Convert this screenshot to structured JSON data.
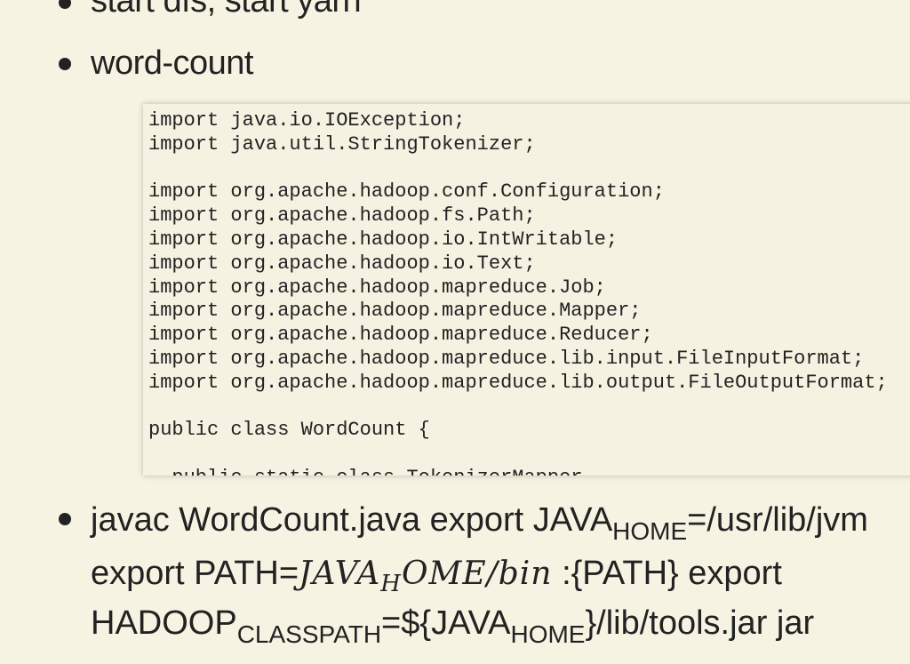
{
  "slide": {
    "bullets": [
      {
        "text": "start dfs, start yarn"
      },
      {
        "text": "word-count"
      }
    ],
    "code": {
      "lines": [
        "import java.io.IOException;",
        "import java.util.StringTokenizer;",
        "",
        "import org.apache.hadoop.conf.Configuration;",
        "import org.apache.hadoop.fs.Path;",
        "import org.apache.hadoop.io.IntWritable;",
        "import org.apache.hadoop.io.Text;",
        "import org.apache.hadoop.mapreduce.Job;",
        "import org.apache.hadoop.mapreduce.Mapper;",
        "import org.apache.hadoop.mapreduce.Reducer;",
        "import org.apache.hadoop.mapreduce.lib.input.FileInputFormat;",
        "import org.apache.hadoop.mapreduce.lib.output.FileOutputFormat;",
        "",
        "public class WordCount {",
        "",
        "  public static class TokenizerMapper"
      ]
    },
    "para": {
      "l1_a": "javac WordCount.java export JAVA",
      "l1_sub": "HOME",
      "l1_b": "=/usr/lib/jvm",
      "l2_a": "export PATH=",
      "l2_math_a": "JAVA",
      "l2_math_sub": "H",
      "l2_math_b": "OME/bin",
      "l2_b": ":{PATH} export",
      "l3_a": "HADOOP",
      "l3_sub1": "CLASSPATH",
      "l3_b": "=${JAVA",
      "l3_sub2": "HOME",
      "l3_c": "}/lib/tools.jar jar"
    }
  }
}
